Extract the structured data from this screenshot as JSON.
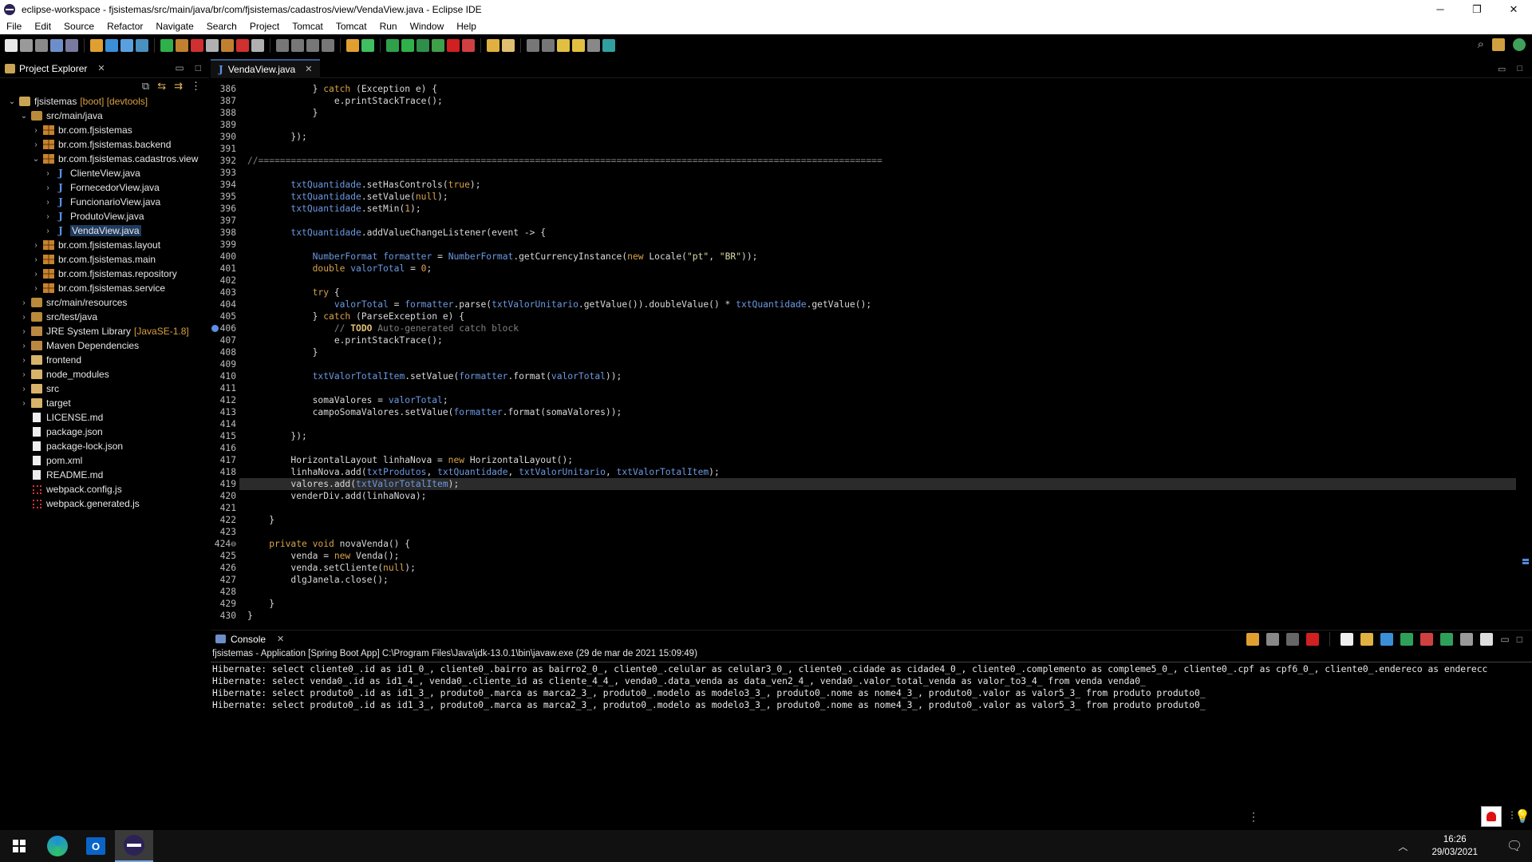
{
  "window": {
    "title": "eclipse-workspace - fjsistemas/src/main/java/br/com/fjsistemas/cadastros/view/VendaView.java - Eclipse IDE",
    "minimize": "─",
    "maximize": "❐",
    "close": "✕"
  },
  "menu": [
    "File",
    "Edit",
    "Source",
    "Refactor",
    "Navigate",
    "Search",
    "Project",
    "Tomcat",
    "Tomcat",
    "Run",
    "Window",
    "Help"
  ],
  "explorer": {
    "title": "Project Explorer",
    "close": "✕",
    "tree": [
      {
        "label": "fjsistemas",
        "deco": "[boot] [devtools]",
        "icon": "project",
        "arrow": "⌄",
        "indent": 0
      },
      {
        "label": "src/main/java",
        "icon": "srcfolder",
        "arrow": "⌄",
        "indent": 1
      },
      {
        "label": "br.com.fjsistemas",
        "icon": "pkg",
        "arrow": "›",
        "indent": 2
      },
      {
        "label": "br.com.fjsistemas.backend",
        "icon": "pkg",
        "arrow": "›",
        "indent": 2
      },
      {
        "label": "br.com.fjsistemas.cadastros.view",
        "icon": "pkg",
        "arrow": "⌄",
        "indent": 2
      },
      {
        "label": "ClienteView.java",
        "icon": "java",
        "arrow": "›",
        "indent": 3
      },
      {
        "label": "FornecedorView.java",
        "icon": "java",
        "arrow": "›",
        "indent": 3
      },
      {
        "label": "FuncionarioView.java",
        "icon": "java",
        "arrow": "›",
        "indent": 3
      },
      {
        "label": "ProdutoView.java",
        "icon": "java",
        "arrow": "›",
        "indent": 3
      },
      {
        "label": "VendaView.java",
        "icon": "java",
        "arrow": "›",
        "indent": 3,
        "selected": true
      },
      {
        "label": "br.com.fjsistemas.layout",
        "icon": "pkg",
        "arrow": "›",
        "indent": 2
      },
      {
        "label": "br.com.fjsistemas.main",
        "icon": "pkg",
        "arrow": "›",
        "indent": 2
      },
      {
        "label": "br.com.fjsistemas.repository",
        "icon": "pkg",
        "arrow": "›",
        "indent": 2
      },
      {
        "label": "br.com.fjsistemas.service",
        "icon": "pkg",
        "arrow": "›",
        "indent": 2
      },
      {
        "label": "src/main/resources",
        "icon": "srcfolder",
        "arrow": "›",
        "indent": 1
      },
      {
        "label": "src/test/java",
        "icon": "srcfolder",
        "arrow": "›",
        "indent": 1
      },
      {
        "label": "JRE System Library",
        "deco": "[JavaSE-1.8]",
        "icon": "lib",
        "arrow": "›",
        "indent": 1
      },
      {
        "label": "Maven Dependencies",
        "icon": "lib",
        "arrow": "›",
        "indent": 1
      },
      {
        "label": "frontend",
        "icon": "folder",
        "arrow": "›",
        "indent": 1
      },
      {
        "label": "node_modules",
        "icon": "folder",
        "arrow": "›",
        "indent": 1
      },
      {
        "label": "src",
        "icon": "folder",
        "arrow": "›",
        "indent": 1
      },
      {
        "label": "target",
        "icon": "folder",
        "arrow": "›",
        "indent": 1
      },
      {
        "label": "LICENSE.md",
        "icon": "file",
        "arrow": "",
        "indent": 1
      },
      {
        "label": "package.json",
        "icon": "file",
        "arrow": "",
        "indent": 1
      },
      {
        "label": "package-lock.json",
        "icon": "file",
        "arrow": "",
        "indent": 1
      },
      {
        "label": "pom.xml",
        "icon": "file",
        "arrow": "",
        "indent": 1
      },
      {
        "label": "README.md",
        "icon": "file",
        "arrow": "",
        "indent": 1
      },
      {
        "label": "webpack.config.js",
        "icon": "jsfile",
        "arrow": "",
        "indent": 1
      },
      {
        "label": "webpack.generated.js",
        "icon": "jsfile",
        "arrow": "",
        "indent": 1
      }
    ]
  },
  "editor": {
    "tab_label": "VendaView.java",
    "close": "✕",
    "lines": [
      {
        "n": "386",
        "t": "            } catch (Exception e) {"
      },
      {
        "n": "387",
        "t": "                e.printStackTrace();"
      },
      {
        "n": "388",
        "t": "            }"
      },
      {
        "n": "389",
        "t": ""
      },
      {
        "n": "390",
        "t": "        });"
      },
      {
        "n": "391",
        "t": ""
      },
      {
        "n": "392",
        "t": "//==================================================================================================================="
      },
      {
        "n": "393",
        "t": ""
      },
      {
        "n": "394",
        "t": "        txtQuantidade.setHasControls(true);"
      },
      {
        "n": "395",
        "t": "        txtQuantidade.setValue(null);"
      },
      {
        "n": "396",
        "t": "        txtQuantidade.setMin(1);"
      },
      {
        "n": "397",
        "t": ""
      },
      {
        "n": "398",
        "t": "        txtQuantidade.addValueChangeListener(event -> {"
      },
      {
        "n": "399",
        "t": ""
      },
      {
        "n": "400",
        "t": "            NumberFormat formatter = NumberFormat.getCurrencyInstance(new Locale(\"pt\", \"BR\"));"
      },
      {
        "n": "401",
        "t": "            double valorTotal = 0;"
      },
      {
        "n": "402",
        "t": ""
      },
      {
        "n": "403",
        "t": "            try {"
      },
      {
        "n": "404",
        "t": "                valorTotal = formatter.parse(txtValorUnitario.getValue()).doubleValue() * txtQuantidade.getValue();"
      },
      {
        "n": "405",
        "t": "            } catch (ParseException e) {"
      },
      {
        "n": "406",
        "t": "                // TODO Auto-generated catch block",
        "bp": true
      },
      {
        "n": "407",
        "t": "                e.printStackTrace();"
      },
      {
        "n": "408",
        "t": "            }"
      },
      {
        "n": "409",
        "t": ""
      },
      {
        "n": "410",
        "t": "            txtValorTotalItem.setValue(formatter.format(valorTotal));"
      },
      {
        "n": "411",
        "t": ""
      },
      {
        "n": "412",
        "t": "            somaValores = valorTotal;"
      },
      {
        "n": "413",
        "t": "            campoSomaValores.setValue(formatter.format(somaValores));"
      },
      {
        "n": "414",
        "t": ""
      },
      {
        "n": "415",
        "t": "        });"
      },
      {
        "n": "416",
        "t": ""
      },
      {
        "n": "417",
        "t": "        HorizontalLayout linhaNova = new HorizontalLayout();"
      },
      {
        "n": "418",
        "t": "        linhaNova.add(txtProdutos, txtQuantidade, txtValorUnitario, txtValorTotalItem);"
      },
      {
        "n": "419",
        "t": "        valores.add(txtValorTotalItem);",
        "highlight": true
      },
      {
        "n": "420",
        "t": "        venderDiv.add(linhaNova);"
      },
      {
        "n": "421",
        "t": ""
      },
      {
        "n": "422",
        "t": "    }"
      },
      {
        "n": "423",
        "t": ""
      },
      {
        "n": "424",
        "t": "    private void novaVenda() {",
        "fold": true
      },
      {
        "n": "425",
        "t": "        venda = new Venda();"
      },
      {
        "n": "426",
        "t": "        venda.setCliente(null);"
      },
      {
        "n": "427",
        "t": "        dlgJanela.close();"
      },
      {
        "n": "428",
        "t": ""
      },
      {
        "n": "429",
        "t": "    }"
      },
      {
        "n": "430",
        "t": "}"
      }
    ]
  },
  "console": {
    "title": "Console",
    "close": "✕",
    "launch": "fjsistemas - Application [Spring Boot App] C:\\Program Files\\Java\\jdk-13.0.1\\bin\\javaw.exe  (29 de mar de 2021 15:09:49)",
    "output": [
      "Hibernate: select cliente0_.id as id1_0_, cliente0_.bairro as bairro2_0_, cliente0_.celular as celular3_0_, cliente0_.cidade as cidade4_0_, cliente0_.complemento as compleme5_0_, cliente0_.cpf as cpf6_0_, cliente0_.endereco as enderecc",
      "Hibernate: select venda0_.id as id1_4_, venda0_.cliente_id as cliente_4_4_, venda0_.data_venda as data_ven2_4_, venda0_.valor_total_venda as valor_to3_4_ from venda venda0_",
      "Hibernate: select produto0_.id as id1_3_, produto0_.marca as marca2_3_, produto0_.modelo as modelo3_3_, produto0_.nome as nome4_3_, produto0_.valor as valor5_3_ from produto produto0_",
      "Hibernate: select produto0_.id as id1_3_, produto0_.marca as marca2_3_, produto0_.modelo as modelo3_3_, produto0_.nome as nome4_3_, produto0_.valor as valor5_3_ from produto produto0_"
    ]
  },
  "taskbar": {
    "time": "16:26",
    "date": "29/03/2021"
  },
  "icons": {
    "java_glyph": "J",
    "outlook_glyph": "O"
  }
}
